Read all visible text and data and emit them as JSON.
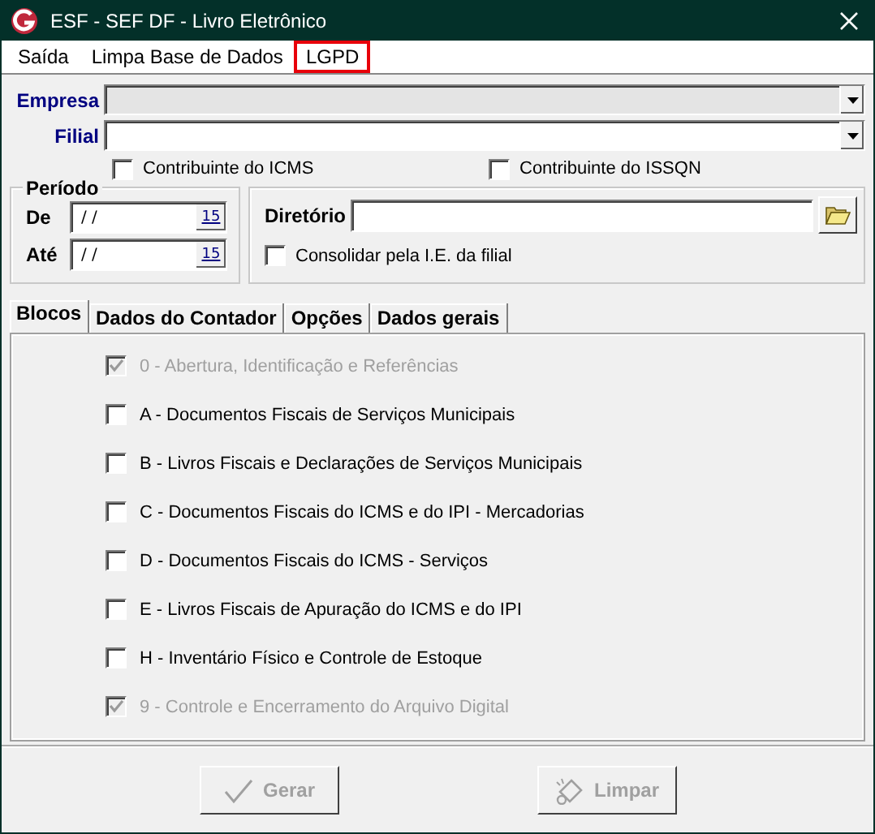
{
  "window": {
    "title": "ESF - SEF DF - Livro Eletrônico"
  },
  "menu": [
    {
      "label": "Saída",
      "highlighted": false
    },
    {
      "label": "Limpa Base de Dados",
      "highlighted": false
    },
    {
      "label": "LGPD",
      "highlighted": true
    }
  ],
  "empresa": {
    "label": "Empresa",
    "disabled": true
  },
  "filial": {
    "label": "Filial",
    "disabled": false
  },
  "contribuinte": [
    {
      "label": "Contribuinte do ICMS",
      "checked": false
    },
    {
      "label": "Contribuinte do ISSQN",
      "checked": false
    }
  ],
  "periodo": {
    "title": "Período",
    "fields": [
      {
        "label": "De",
        "value": " / /",
        "button": "15"
      },
      {
        "label": "Até",
        "value": " / /",
        "button": "15"
      }
    ]
  },
  "diretorio": {
    "label": "Diretório",
    "consolidar": {
      "label": "Consolidar pela I.E. da filial",
      "checked": false
    }
  },
  "tabs": [
    {
      "label": "Blocos",
      "selected": true
    },
    {
      "label": "Dados do Contador",
      "selected": false
    },
    {
      "label": "Opções",
      "selected": false
    },
    {
      "label": "Dados gerais",
      "selected": false
    }
  ],
  "blocos": [
    {
      "label": "0 - Abertura, Identificação e Referências",
      "checked": true,
      "disabled": true
    },
    {
      "label": "A - Documentos Fiscais de Serviços Municipais",
      "checked": false,
      "disabled": false
    },
    {
      "label": "B - Livros Fiscais e Declarações de Serviços Municipais",
      "checked": false,
      "disabled": false
    },
    {
      "label": "C - Documentos Fiscais do ICMS e do IPI - Mercadorias",
      "checked": false,
      "disabled": false
    },
    {
      "label": "D - Documentos Fiscais do ICMS - Serviços",
      "checked": false,
      "disabled": false
    },
    {
      "label": "E - Livros Fiscais de Apuração do ICMS e do IPI",
      "checked": false,
      "disabled": false
    },
    {
      "label": "H - Inventário Físico e Controle de Estoque",
      "checked": false,
      "disabled": false
    },
    {
      "label": "9 - Controle e Encerramento do Arquivo Digital",
      "checked": true,
      "disabled": true
    }
  ],
  "buttons": [
    {
      "label": "Gerar",
      "kind": "check",
      "disabled": true
    },
    {
      "label": "Limpar",
      "kind": "eraser",
      "disabled": true
    }
  ]
}
